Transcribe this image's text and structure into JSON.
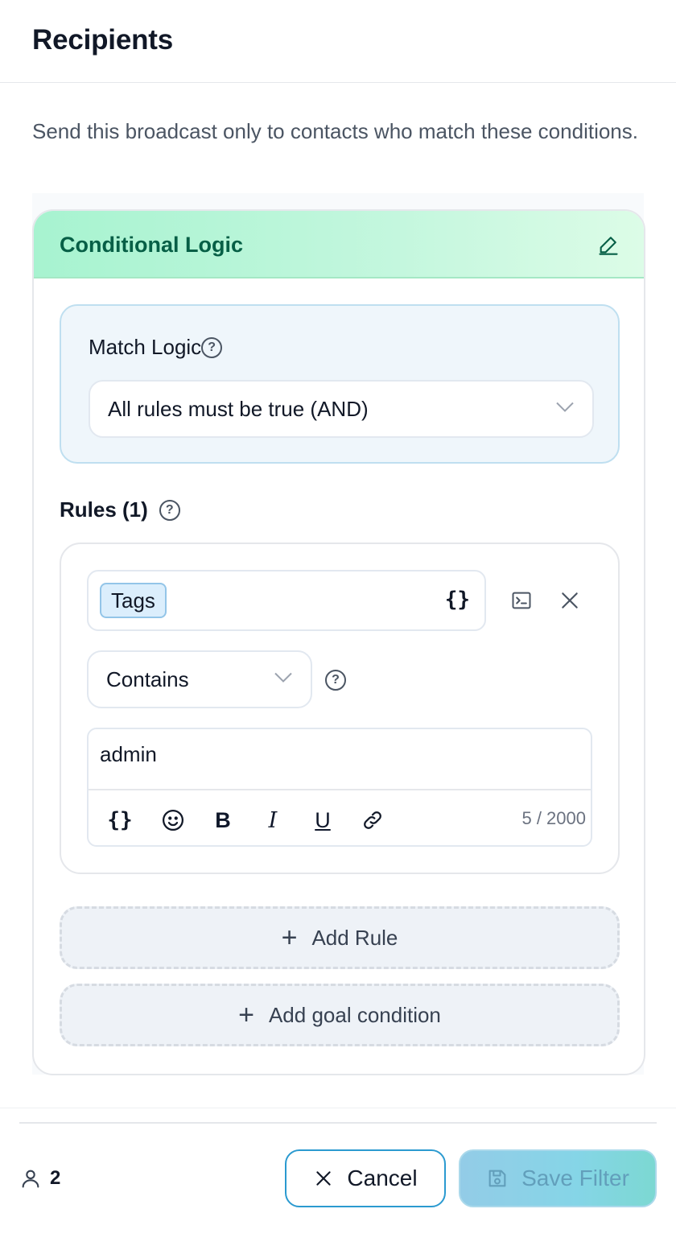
{
  "header": {
    "title": "Recipients"
  },
  "description": "Send this broadcast only to contacts who match these conditions.",
  "card": {
    "title": "Conditional Logic",
    "match_logic": {
      "label": "Match Logic",
      "help": "?",
      "selected": "All rules must be true (AND)"
    },
    "rules": {
      "label": "Rules (1)",
      "help": "?",
      "items": [
        {
          "field": "Tags",
          "variable_icon": "{}",
          "operator": "Contains",
          "operator_help": "?",
          "value": "admin",
          "toolbar": {
            "variable_icon": "{}",
            "bold_label": "B",
            "italic_label": "I",
            "underline_label": "U"
          },
          "counter": "5 / 2000"
        }
      ]
    },
    "add_rule_label": "Add Rule",
    "add_goal_label": "Add goal condition"
  },
  "footer": {
    "recipient_count": "2",
    "cancel_label": "Cancel",
    "save_label": "Save Filter"
  },
  "colors": {
    "accent_green": "#065f46",
    "accent_blue": "#2b9ad0"
  }
}
